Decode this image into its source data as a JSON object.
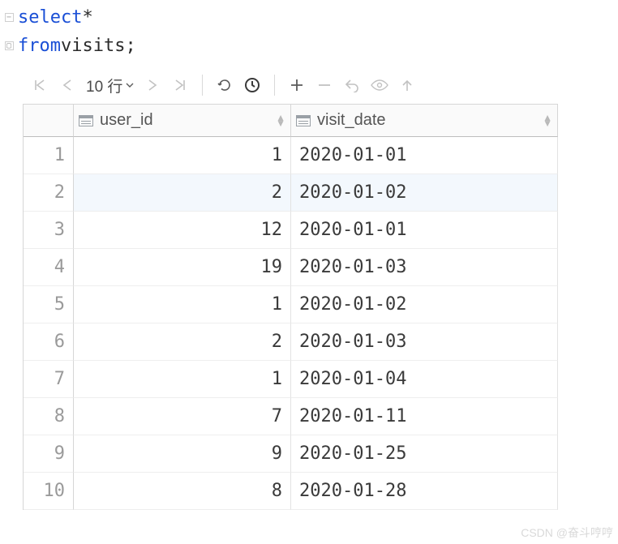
{
  "sql": {
    "line1_kw": "select",
    "line1_rest": " *",
    "line2_kw": "from",
    "line2_rest": " visits;"
  },
  "toolbar": {
    "pager_label": "10 行"
  },
  "columns": {
    "c1": "user_id",
    "c2": "visit_date"
  },
  "chart_data": {
    "type": "table",
    "columns": [
      "user_id",
      "visit_date"
    ],
    "rows": [
      {
        "n": "1",
        "user_id": "1",
        "visit_date": "2020-01-01"
      },
      {
        "n": "2",
        "user_id": "2",
        "visit_date": "2020-01-02"
      },
      {
        "n": "3",
        "user_id": "12",
        "visit_date": "2020-01-01"
      },
      {
        "n": "4",
        "user_id": "19",
        "visit_date": "2020-01-03"
      },
      {
        "n": "5",
        "user_id": "1",
        "visit_date": "2020-01-02"
      },
      {
        "n": "6",
        "user_id": "2",
        "visit_date": "2020-01-03"
      },
      {
        "n": "7",
        "user_id": "1",
        "visit_date": "2020-01-04"
      },
      {
        "n": "8",
        "user_id": "7",
        "visit_date": "2020-01-11"
      },
      {
        "n": "9",
        "user_id": "9",
        "visit_date": "2020-01-25"
      },
      {
        "n": "10",
        "user_id": "8",
        "visit_date": "2020-01-28"
      }
    ]
  },
  "watermark": "CSDN @奋斗哼哼"
}
